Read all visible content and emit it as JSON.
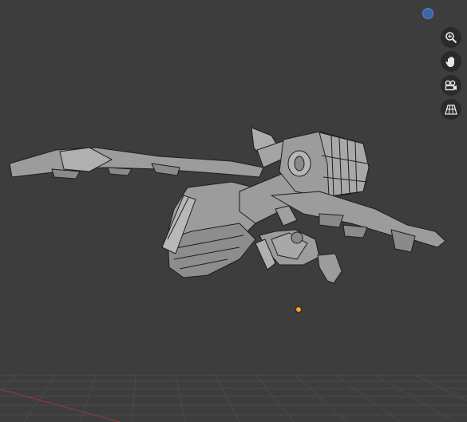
{
  "viewport": {
    "background_color": "#3d3d3d",
    "grid_color": "#4a4a4a",
    "x_axis_color": "#8a3a3a",
    "origin_color": "#f5a623",
    "mesh_fill_color": "#9c9c9c",
    "mesh_edge_color": "#1e1e1e"
  },
  "gizmo": {
    "icon": "navigation-gizmo-icon",
    "color": "#3a67a8"
  },
  "nav_buttons": [
    {
      "name": "zoom-button",
      "icon": "zoom-icon"
    },
    {
      "name": "pan-button",
      "icon": "hand-icon"
    },
    {
      "name": "camera-view-button",
      "icon": "camera-icon"
    },
    {
      "name": "perspective-toggle-button",
      "icon": "grid-icon"
    }
  ]
}
